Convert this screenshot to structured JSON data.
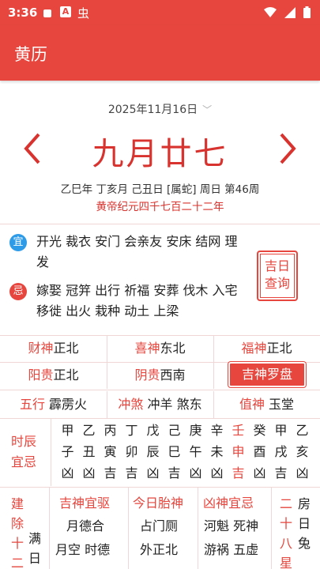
{
  "status": {
    "time": "3:36",
    "app_icon_text": "A",
    "extra_glyph": "虫"
  },
  "appbar": {
    "title": "黄历"
  },
  "date": {
    "solar": "2025年11月16日",
    "lunar": "九月廿七",
    "ganzhi": "乙巳年 丁亥月 己丑日 [属蛇] 周日 第46周",
    "huangdi": "黄帝纪元四千七百二十二年"
  },
  "yi": {
    "badge": "宜",
    "text": "开光 裁衣 安门 会亲友 安床 结网 理发"
  },
  "ji": {
    "badge": "忌",
    "text": "嫁娶 冠笄 出行 祈福 安葬 伐木 入宅 移徙 出火 栽种 动土 上梁"
  },
  "jiri_button": {
    "line1": "吉日",
    "line2": "查询"
  },
  "gods_row1": [
    {
      "k": "财神",
      "v": "正北"
    },
    {
      "k": "喜神",
      "v": "东北"
    },
    {
      "k": "福神",
      "v": "正北"
    }
  ],
  "gods_row2": [
    {
      "k": "阳贵",
      "v": "正北"
    },
    {
      "k": "阴贵",
      "v": "西南"
    }
  ],
  "luopan_button": "吉神罗盘",
  "row3": {
    "wuxing_k": "五行",
    "wuxing_v": "霹雳火",
    "chongsha_k": "冲煞",
    "chongsha_v": "冲羊 煞东",
    "zhishen_k": "值神",
    "zhishen_v": "玉堂"
  },
  "shichen": {
    "line1": "时辰",
    "line2": "宜忌"
  },
  "hours": {
    "stems": [
      "甲",
      "乙",
      "丙",
      "丁",
      "戊",
      "己",
      "庚",
      "辛",
      "壬",
      "癸",
      "甲",
      "乙"
    ],
    "branches": [
      "子",
      "丑",
      "寅",
      "卯",
      "辰",
      "巳",
      "午",
      "未",
      "申",
      "酉",
      "戌",
      "亥"
    ],
    "luck": [
      "凶",
      "凶",
      "吉",
      "吉",
      "凶",
      "吉",
      "凶",
      "凶",
      "吉",
      "凶",
      "吉",
      "凶"
    ],
    "highlight_index": 8
  },
  "bottom": {
    "left_vertical": [
      "建",
      "除",
      "十",
      "二"
    ],
    "left_second": [
      "满",
      "日"
    ],
    "col1_title": "吉神宜驱",
    "col1_lines": [
      "月德合",
      "月空 时德"
    ],
    "col2_title": "今日胎神",
    "col2_lines": [
      "占门厕",
      "外正北"
    ],
    "col3_title": "凶神宜忌",
    "col3_lines": [
      "河魁 死神",
      "游祸 五虚"
    ],
    "right_vertical_red": [
      "二",
      "十",
      "八",
      "星"
    ],
    "right_vertical_black": [
      "房",
      "日",
      "兔"
    ]
  },
  "colors": {
    "primary": "#e6463d",
    "yi_blue": "#2e9be8"
  }
}
